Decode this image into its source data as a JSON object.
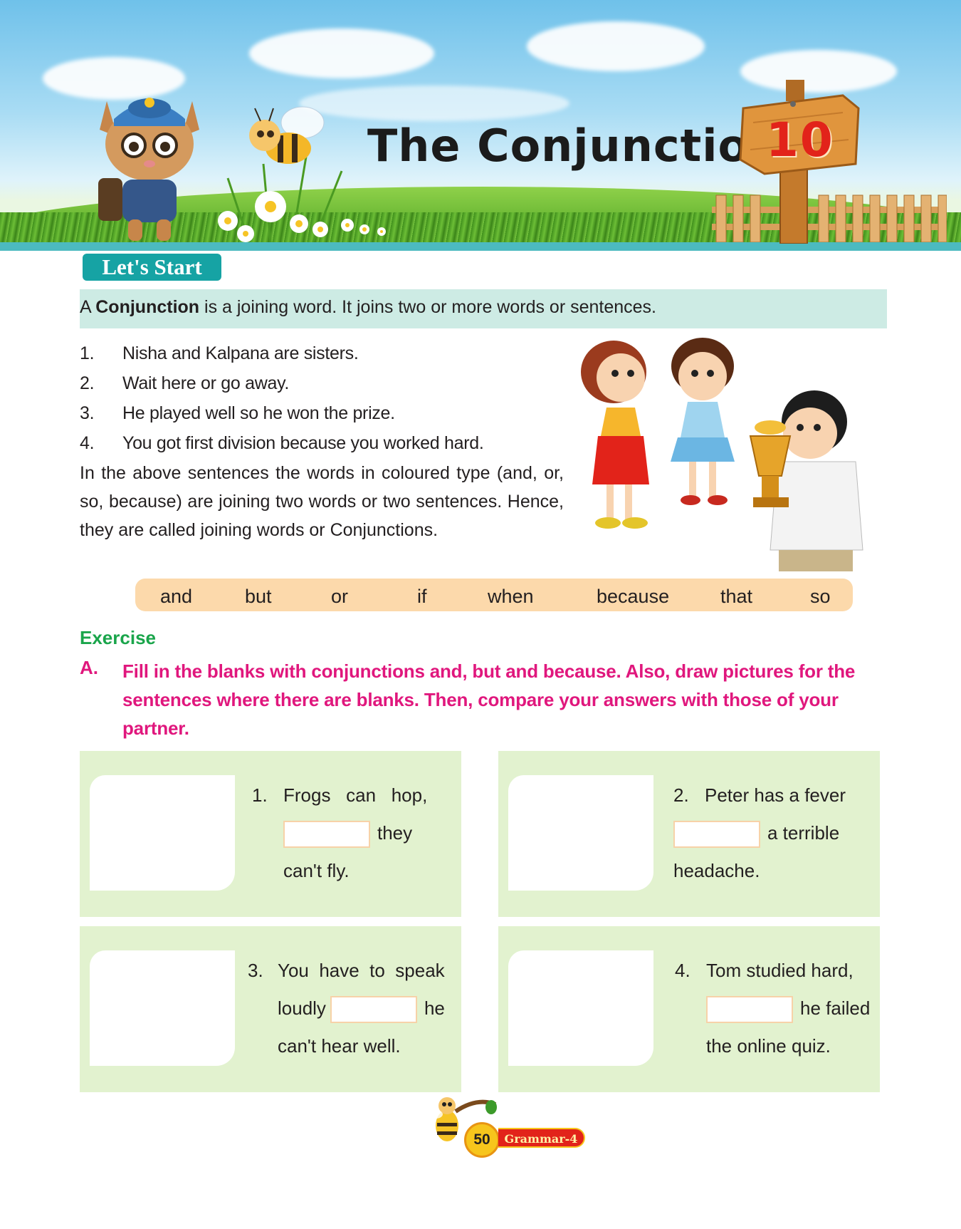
{
  "chapter": {
    "title": "The  Conjunction",
    "number": "10"
  },
  "lets_start": {
    "label": "Let's Start"
  },
  "definition": {
    "prefix": "A ",
    "term": "Conjunction",
    "rest": " is a joining word. It joins two or more words or sentences."
  },
  "examples": [
    {
      "num": "1.",
      "text": "Nisha and Kalpana are sisters."
    },
    {
      "num": "2.",
      "text": "Wait here or go away."
    },
    {
      "num": "3.",
      "text": "He played well so he won the prize."
    },
    {
      "num": "4.",
      "text": "You got first division because you worked hard."
    }
  ],
  "explanation": "In the above sentences the words in coloured type (and, or, so, because) are joining two words or two sentences. Hence, they are called joining words or Conjunctions.",
  "conjunctions": [
    "and",
    "but",
    "or",
    "if",
    "when",
    "because",
    "that",
    "so"
  ],
  "exercise": {
    "heading": "Exercise",
    "letter": "A.",
    "instruction": "Fill in the blanks with conjunctions and, but and because. Also, draw pictures for the sentences where there are blanks. Then, compare your answers with those of your partner.",
    "items": [
      {
        "num": "1.",
        "line1": "Frogs   can   hop,",
        "after_blank": "they",
        "line3": "can't fly."
      },
      {
        "num": "2.",
        "line1": "Peter has a fever",
        "after_blank": "a terrible",
        "line3": "headache."
      },
      {
        "num": "3.",
        "line1": "You  have  to  speak",
        "before_blank": "loudly",
        "after_blank": "he",
        "line3": "can't hear well."
      },
      {
        "num": "4.",
        "line1": "Tom studied hard,",
        "after_blank": "he failed",
        "line3": "the online quiz."
      }
    ]
  },
  "footer": {
    "page_number": "50",
    "book": "Grammar-4"
  }
}
